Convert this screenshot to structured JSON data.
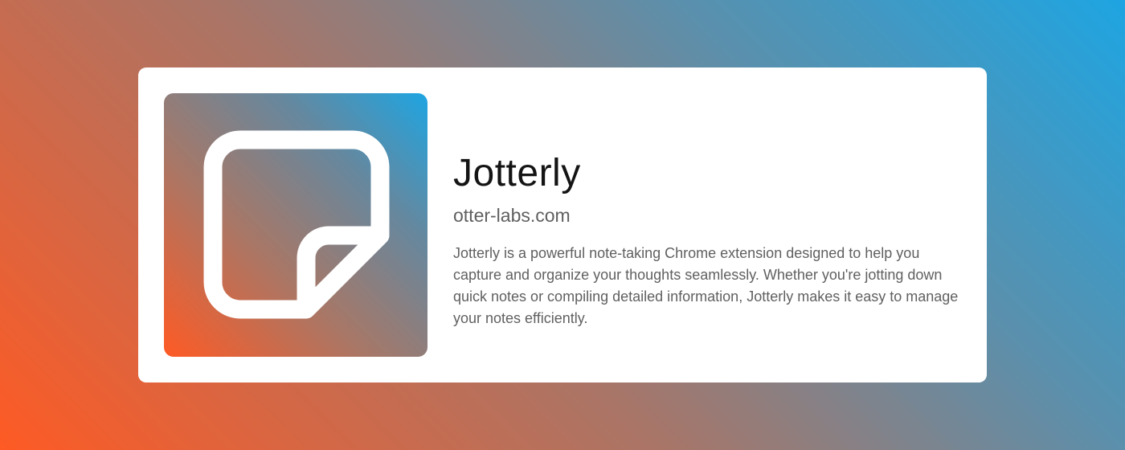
{
  "extension": {
    "name": "Jotterly",
    "domain": "otter-labs.com",
    "description": "Jotterly is a powerful note-taking Chrome extension designed to help you capture and organize your thoughts seamlessly. Whether you're jotting down quick notes or compiling detailed information, Jotterly makes it easy to manage your notes efficiently."
  },
  "icon": {
    "name": "sticky-note-icon"
  },
  "colors": {
    "gradient_start": "#fe5a24",
    "gradient_end": "#1ea5e2",
    "card_background": "#ffffff",
    "title_text": "#141414",
    "body_text": "#606060"
  }
}
